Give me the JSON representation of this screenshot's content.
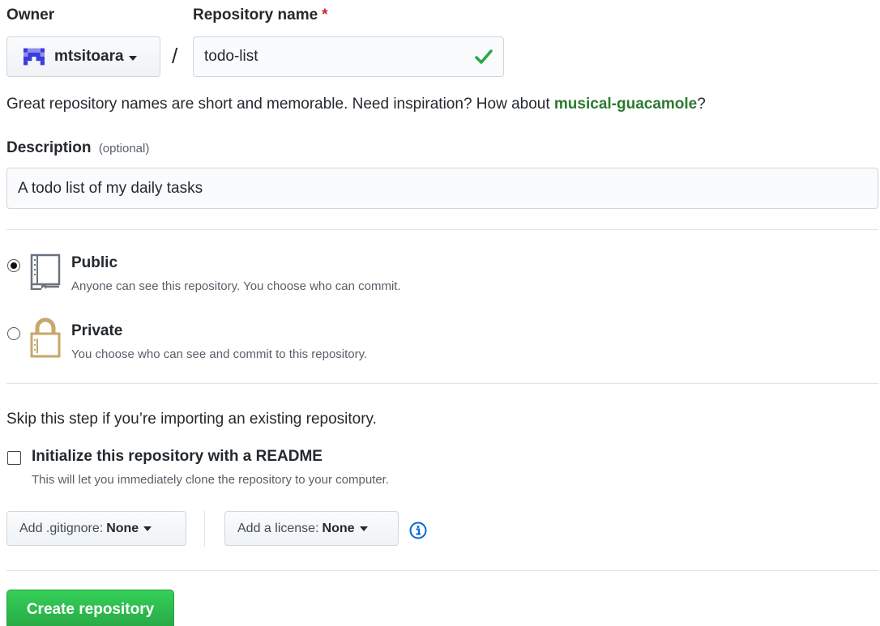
{
  "owner": {
    "label": "Owner",
    "value": "mtsitoara"
  },
  "repository": {
    "label": "Repository name",
    "required_marker": "*",
    "value": "todo-list"
  },
  "hint": {
    "text": "Great repository names are short and memorable. Need inspiration? How about",
    "suggestion": "musical-guacamole",
    "suffix": "?"
  },
  "description": {
    "label": "Description",
    "optional": "(optional)",
    "value": "A todo list of my daily tasks"
  },
  "visibility": {
    "public": {
      "title": "Public",
      "desc": "Anyone can see this repository. You choose who can commit.",
      "selected": true
    },
    "private": {
      "title": "Private",
      "desc": "You choose who can see and commit to this repository.",
      "selected": false
    }
  },
  "import_hint": "Skip this step if you’re importing an existing repository.",
  "readme": {
    "label": "Initialize this repository with a README",
    "desc": "This will let you immediately clone the repository to your computer.",
    "checked": false
  },
  "gitignore": {
    "label": "Add .gitignore:",
    "value": "None"
  },
  "license": {
    "label": "Add a license:",
    "value": "None"
  },
  "submit": {
    "label": "Create repository"
  },
  "colors": {
    "accent_green": "#28a745",
    "suggestion_green": "#2c7a2f",
    "info_blue": "#0366d6",
    "required_red": "#cb2431",
    "avatar_blue": "#3b3bdb"
  },
  "icons": [
    "identicon-avatar",
    "caret-down-icon",
    "check-icon",
    "repo-icon",
    "lock-icon",
    "info-icon"
  ]
}
